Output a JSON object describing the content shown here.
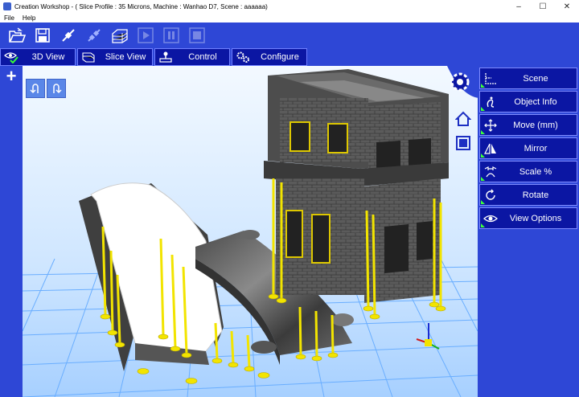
{
  "window": {
    "title": "Creation Workshop -   ( Slice Profile : 35 Microns, Machine : Wanhao D7, Scene : aaaaaa)",
    "controls": [
      "minimize",
      "maximize",
      "close"
    ]
  },
  "menu": {
    "items": [
      "File",
      "Help"
    ]
  },
  "toolbar": {
    "buttons": [
      {
        "name": "open-icon",
        "enabled": true
      },
      {
        "name": "save-icon",
        "enabled": true
      },
      {
        "name": "connect-icon",
        "enabled": true
      },
      {
        "name": "disconnect-icon",
        "enabled": true
      },
      {
        "name": "slice-icon",
        "enabled": true
      },
      {
        "name": "play-icon",
        "enabled": false
      },
      {
        "name": "pause-icon",
        "enabled": false
      },
      {
        "name": "stop-icon",
        "enabled": false
      }
    ]
  },
  "tabs": [
    {
      "label": "3D View",
      "icon": "eye-check-icon"
    },
    {
      "label": "Slice View",
      "icon": "slice-view-icon"
    },
    {
      "label": "Control",
      "icon": "joystick-icon"
    },
    {
      "label": "Configure",
      "icon": "gears-icon"
    }
  ],
  "right_panel": {
    "items": [
      {
        "label": "Scene",
        "icon": "axes-icon"
      },
      {
        "label": "Object Info",
        "icon": "info-icon"
      },
      {
        "label": "Move (mm)",
        "icon": "move-arrows-icon"
      },
      {
        "label": "Mirror",
        "icon": "mirror-icon"
      },
      {
        "label": "Scale %",
        "icon": "scale-icon"
      },
      {
        "label": "Rotate",
        "icon": "rotate-icon"
      },
      {
        "label": "View Options",
        "icon": "eye-icon"
      }
    ]
  },
  "colors": {
    "panel_blue": "#2e47d6",
    "button_navy": "#0b16a3",
    "support_yellow": "#f2e400",
    "model_gray": "#555555",
    "grid_blue": "#6aaeff"
  }
}
